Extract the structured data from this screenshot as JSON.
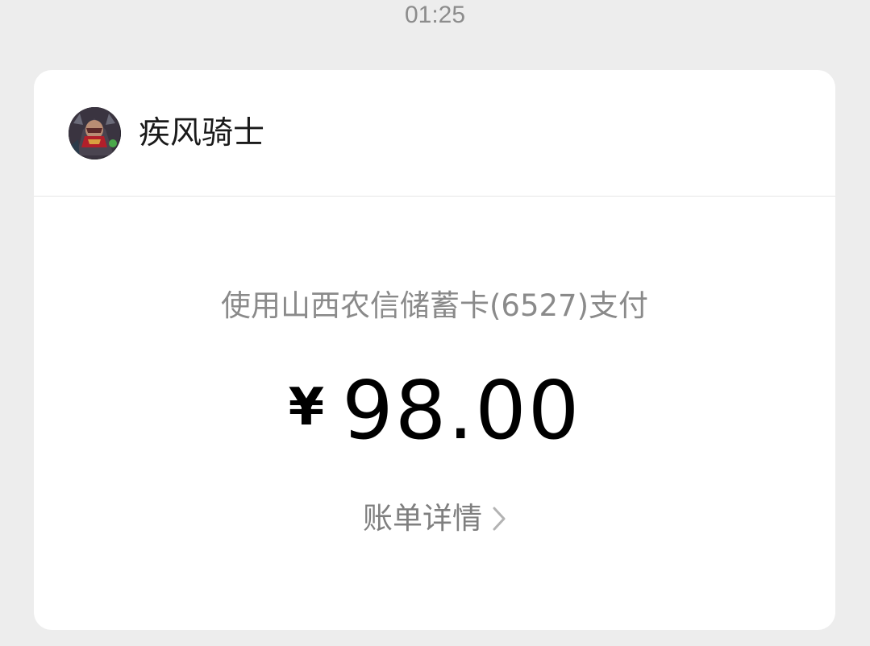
{
  "timestamp": "01:25",
  "sender": {
    "name": "疾风骑士",
    "avatar_icon": "avatar-knight-icon"
  },
  "payment": {
    "method": "使用山西农信储蓄卡(6527)支付",
    "currency_symbol": "¥",
    "amount": "98.00"
  },
  "bill_detail": {
    "label": "账单详情",
    "icon": "chevron-right-icon"
  },
  "colors": {
    "background": "#ededed",
    "card": "#ffffff",
    "secondary_text": "#8a8a8a",
    "primary_text": "#000000"
  }
}
